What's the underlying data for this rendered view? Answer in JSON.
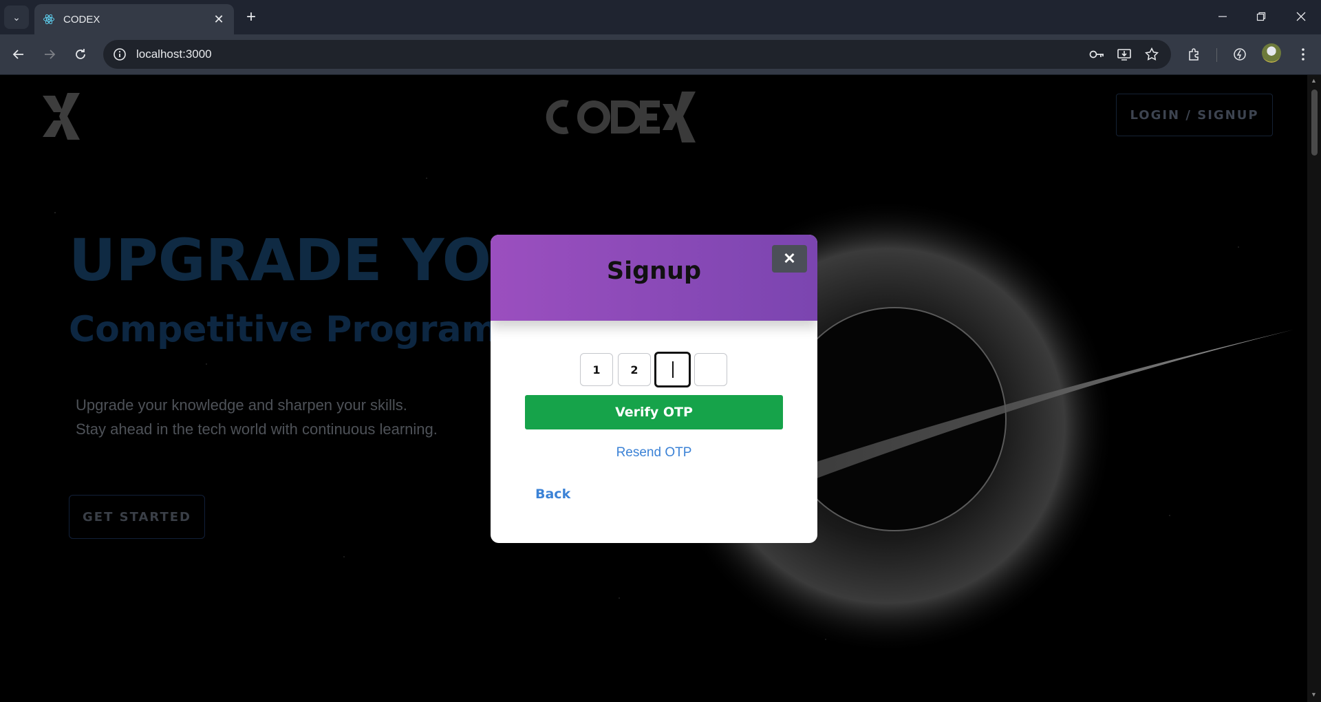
{
  "browser": {
    "tab_title": "CODEX",
    "url": "localhost:3000",
    "new_tab_symbol": "+",
    "tab_close_symbol": "✕"
  },
  "site": {
    "login_label": "LOGIN / SIGNUP",
    "hero_title": "UPGRADE YOUR",
    "hero_subtitle": "Competitive Programming",
    "hero_desc_1": "Upgrade your knowledge and sharpen your skills.",
    "hero_desc_2": "Stay ahead in the tech world with continuous learning.",
    "cta_label": "GET STARTED"
  },
  "modal": {
    "title": "Signup",
    "close_symbol": "✕",
    "otp_digits": [
      "1",
      "2",
      "",
      ""
    ],
    "active_otp_index": 2,
    "verify_label": "Verify OTP",
    "resend_label": "Resend OTP",
    "back_label": "Back"
  },
  "colors": {
    "modal_header_start": "#9b4fbf",
    "modal_header_end": "#7b45b0",
    "verify_button": "#16a34a",
    "link": "#3b82d6"
  }
}
